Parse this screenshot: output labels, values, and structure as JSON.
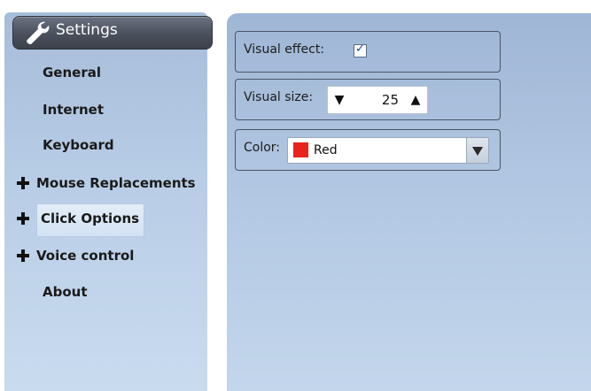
{
  "sidebar": {
    "title": "Settings",
    "items": [
      {
        "label": "General"
      },
      {
        "label": "Internet"
      },
      {
        "label": "Keyboard"
      },
      {
        "label": "Mouse Replacements"
      },
      {
        "label": "Click Options"
      },
      {
        "label": "Voice control"
      },
      {
        "label": "About"
      }
    ]
  },
  "settings": {
    "visual_effect": {
      "label": "Visual effect:",
      "checked": true
    },
    "visual_size": {
      "label": "Visual size:",
      "value": "25",
      "down_arrow": "▼",
      "up_arrow": "▲"
    },
    "color": {
      "label": "Color:",
      "value": "Red",
      "swatch_color": "#e8221d"
    }
  },
  "icons": {
    "header": "wrench-icon",
    "expand": "plus-icon",
    "dropdown": "chevron-down-icon"
  }
}
